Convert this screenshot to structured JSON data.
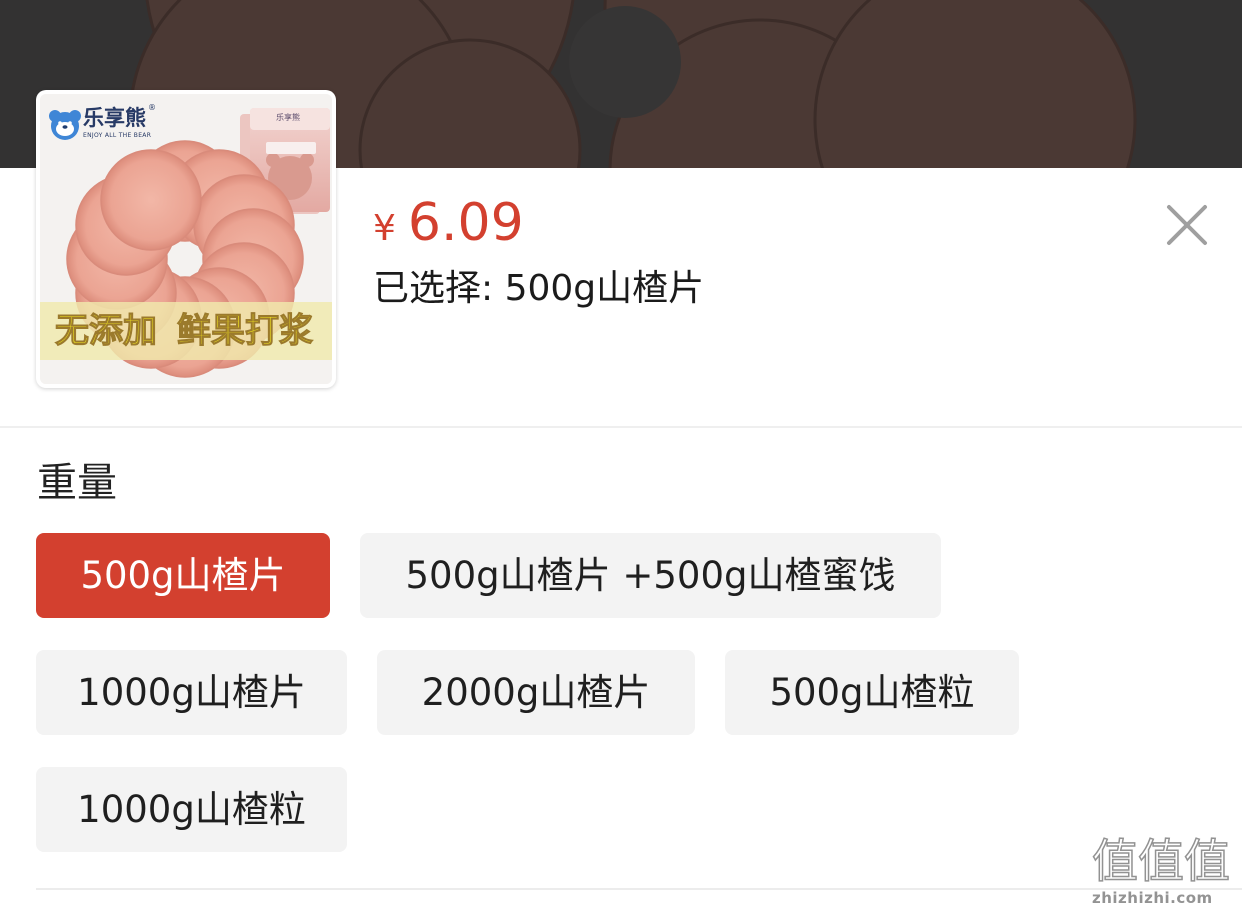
{
  "product": {
    "image": {
      "brand_name": "乐享熊",
      "registered_mark": "®",
      "brand_tagline": "ENJOY ALL THE BEAR",
      "package_brand": "乐享熊",
      "banner_text_1": "无添加",
      "banner_text_2": "鲜果打浆"
    },
    "currency": "¥",
    "price": "6.09",
    "selected_text": "已选择: 500g山楂片"
  },
  "sku": {
    "group_title": "重量",
    "options": [
      {
        "label": "500g山楂片",
        "selected": true
      },
      {
        "label": "500g山楂片 +500g山楂蜜饯",
        "selected": false
      },
      {
        "label": "1000g山楂片",
        "selected": false
      },
      {
        "label": "2000g山楂片",
        "selected": false
      },
      {
        "label": "500g山楂粒",
        "selected": false
      },
      {
        "label": "1000g山楂粒",
        "selected": false
      }
    ]
  },
  "watermark": {
    "mark": "值值值",
    "site": "zhizhizhi.com"
  },
  "colors": {
    "accent": "#d3402f",
    "option_bg": "#f3f3f3",
    "text": "#1b1b1b",
    "close_icon": "#9f9f9f"
  },
  "icons": {
    "close": "close-icon",
    "brand_logo": "bear-logo-icon"
  }
}
